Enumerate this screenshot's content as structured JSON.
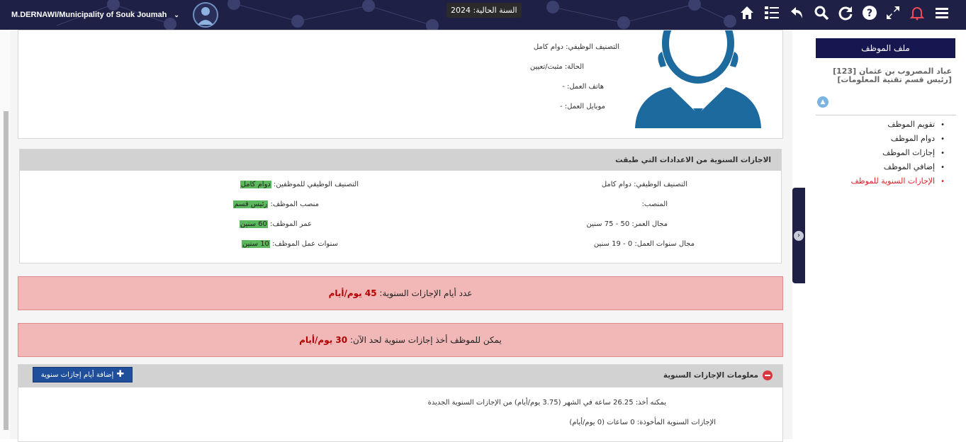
{
  "topbar": {
    "user": "M.DERNAWI/Municipality of Souk Joumah",
    "year_label": "السنة الحالية: 2024",
    "icons": [
      "home-icon",
      "list-icon",
      "back-icon",
      "search-icon",
      "refresh-icon",
      "help-icon",
      "fullscreen-icon",
      "bell-icon",
      "menu-icon"
    ]
  },
  "profile": {
    "classification": "التصنيف الوظيفي: دوام كامل",
    "status": "الحالة: مثبت/تعيين",
    "work_phone": "هاتف العمل: -",
    "work_mobile": "موبايل العمل: -"
  },
  "settings": {
    "title": "الاجازات السنوية من الاعدادات التي طبقت",
    "right": {
      "classification": "التصنيف الوظيفي: دوام كامل",
      "position": "المنصب:",
      "age_range": "مجال العمر: 50 - 75 سنين",
      "years_range": "مجال سنوات العمل: 0 - 19 سنين"
    },
    "left": {
      "classification_label": "التصنيف الوظيفي للموظفين:",
      "classification_value": "دوام كامل",
      "position_label": "منصب الموظف:",
      "position_value": "رئيس قسم",
      "age_label": "عمر الموظف:",
      "age_value": "60 سنين",
      "years_label": "سنوات عمل الموظف:",
      "years_value": "10 سنين"
    }
  },
  "alerts": {
    "days_label": "عدد أيام الإجازات السنوية:",
    "days_value": "45 يوم/أيام",
    "can_take_label": "يمكن للموظف أخذ إجازات سنوية لحد الآن:",
    "can_take_value": "30 يوم/أيام"
  },
  "info": {
    "title": "معلومات الإجازات السنوية",
    "add_button": "إضافة أيام إجازات سنوية",
    "line1": "يمكنه أخذ: 26.25 ساعة في الشهر (3.75 يوم/أيام) من الإجازات السنوية الجديدة",
    "line2": "الإجازات السنوية المأخوذة: 0 ساعات (0 يوم/أيام)"
  },
  "sidebar": {
    "title": "ملف الموظف",
    "employee": "عباد المصروب بن عثمان [123] [رئيس قسم تقنية المعلومات]",
    "menu": [
      "تقويم الموظف",
      "دوام الموظف",
      "إجازات الموظف",
      "إضافي الموظف",
      "الإجازات السنوية للموظف"
    ]
  },
  "colors": {
    "topbar": "#1e2145",
    "accent_active": "#e0202a",
    "highlight": "#5cb85c",
    "alert_bg": "#f2b8b8",
    "button": "#1f4e9a"
  }
}
